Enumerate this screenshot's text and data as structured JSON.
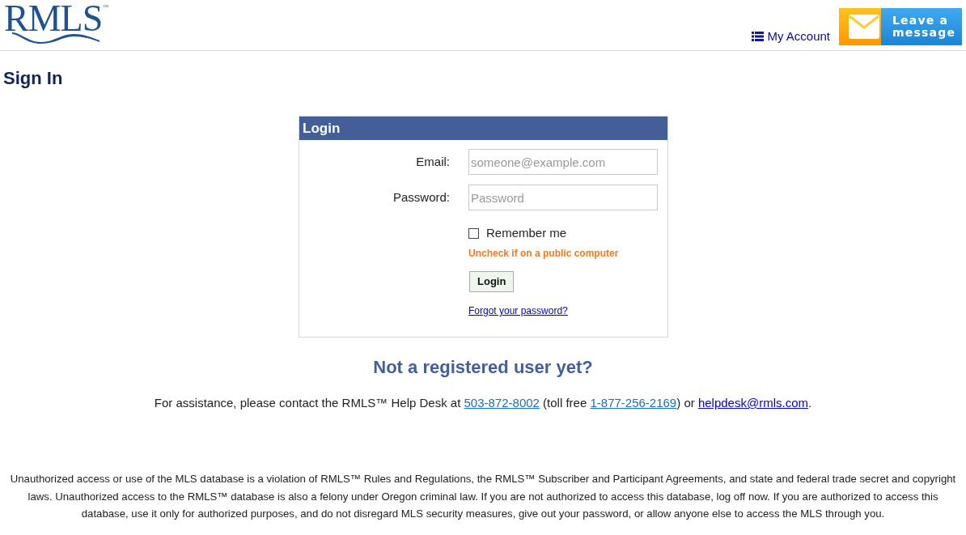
{
  "header": {
    "logo": {
      "text": "RMLS",
      "mark": "™"
    },
    "account_link": "My Account",
    "message_button": "Leave a message"
  },
  "page_title": "Sign In",
  "login_panel": {
    "title": "Login",
    "fields": [
      {
        "label": "Email:",
        "placeholder": "someone@example.com"
      },
      {
        "label": "Password:",
        "placeholder": "Password"
      }
    ],
    "remember": {
      "label": "Remember me",
      "checked": false,
      "hint": "Uncheck if on a public computer"
    },
    "submit": "Login",
    "forgot_link": "Forgot your password?"
  },
  "register_heading": "Not a registered user yet?",
  "help": [
    {
      "kind": "text",
      "text": "For assistance, please contact the RMLS™ Help Desk at "
    },
    {
      "kind": "phone",
      "text": "503-872-8002"
    },
    {
      "kind": "text",
      "text": " (toll free "
    },
    {
      "kind": "phone",
      "text": "1-877-256-2169"
    },
    {
      "kind": "text",
      "text": ") or "
    },
    {
      "kind": "email",
      "text": "helpdesk@rmls.com"
    },
    {
      "kind": "text",
      "text": "."
    }
  ],
  "disclaimer": "Unauthorized access or use of the MLS database is a violation of RMLS™ Rules and Regulations, the RMLS™ Subscriber and Participant Agreements, and state and federal trade secret and copyright laws. Unauthorized access to the RMLS™ database is also a felony under Oregon criminal law. If you are not authorized to access this database, log off now. If you are authorized to access this database, use it only for authorized purposes, and do not disregard MLS security measures, give out your password, or allow anyone else to access the MLS through you."
}
